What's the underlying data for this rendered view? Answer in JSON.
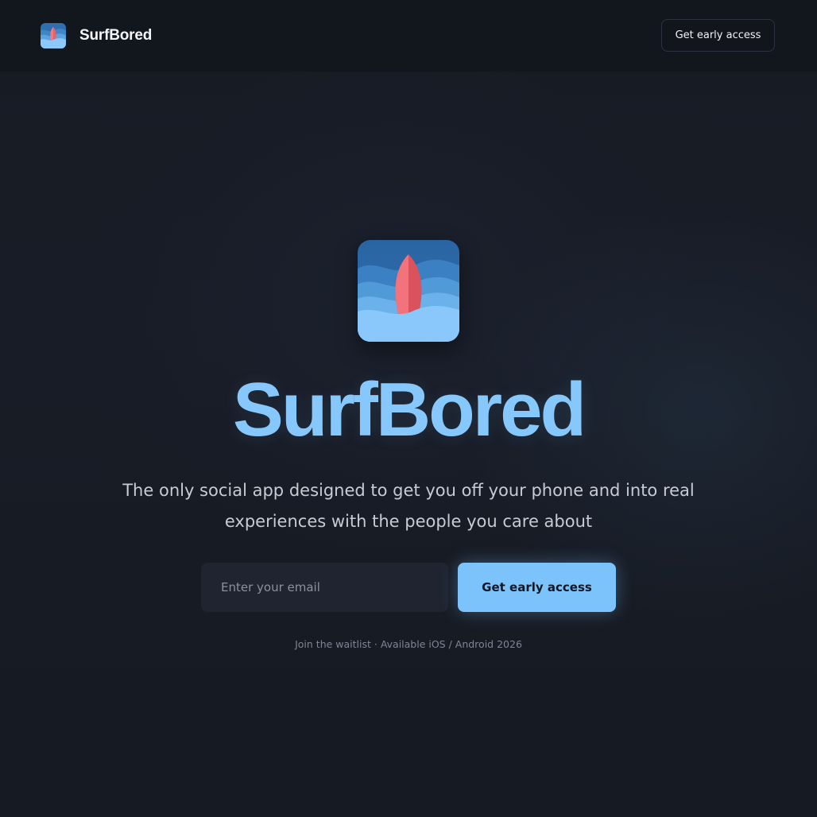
{
  "header": {
    "brand_name": "SurfBored",
    "logo_icon": "surfboard-wave-logo-icon",
    "cta_label": "Get early access"
  },
  "hero": {
    "icon": "surfboard-wave-app-icon",
    "title": "SurfBored",
    "tagline": "The only social app designed to get you off your phone and into real experiences with the people you care about"
  },
  "signup": {
    "email_placeholder": "Enter your email",
    "email_value": "",
    "button_label": "Get early access"
  },
  "footnote": "Join the waitlist · Available iOS / Android 2026",
  "colors": {
    "background": "#161a23",
    "accent": "#7cc3fb",
    "title": "#86c8fb",
    "surfboard": "#e8606a"
  }
}
